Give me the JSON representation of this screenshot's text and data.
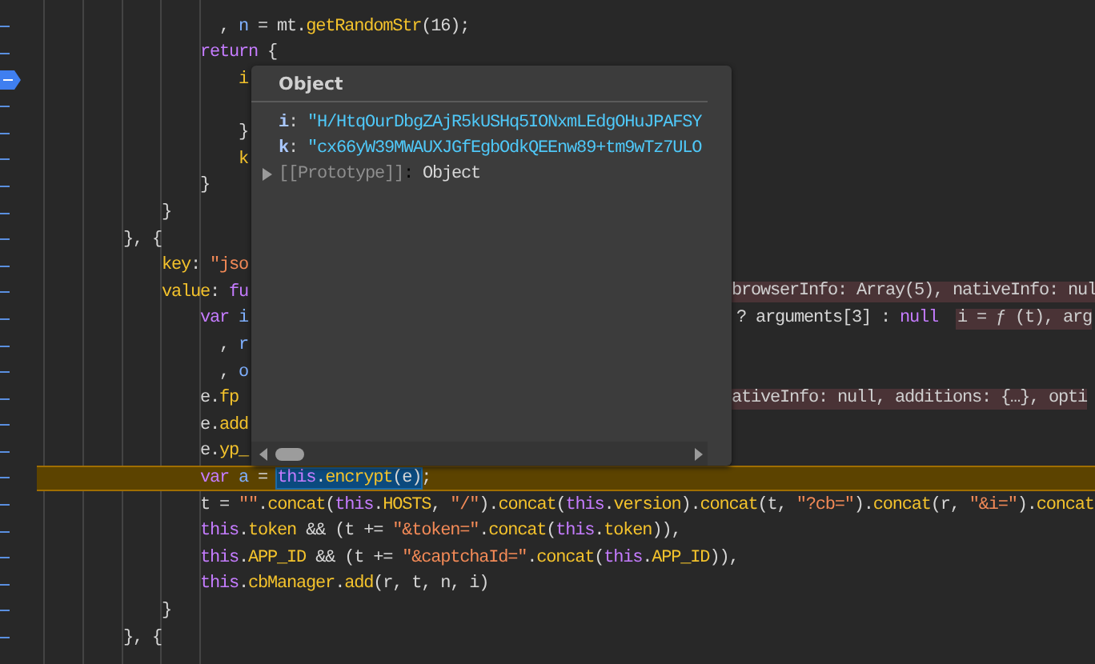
{
  "lines": [
    {
      "breakpoint": false,
      "current": false,
      "tokens": [
        {
          "kind": "pl",
          "t": "                  , "
        },
        {
          "kind": "id",
          "t": "n"
        },
        {
          "kind": "pl",
          "t": " = mt."
        },
        {
          "kind": "fn",
          "t": "getRandomStr"
        },
        {
          "kind": "pl",
          "t": "(16);"
        }
      ]
    },
    {
      "breakpoint": false,
      "current": false,
      "tokens": [
        {
          "kind": "kw",
          "t": "                return"
        },
        {
          "kind": "pl",
          "t": " {"
        }
      ]
    },
    {
      "breakpoint": true,
      "current": false,
      "tokens": [
        {
          "kind": "fn",
          "t": "                    i"
        }
      ]
    },
    {
      "breakpoint": false,
      "current": false
    },
    {
      "breakpoint": false,
      "current": false,
      "tokens": [
        {
          "kind": "pl",
          "t": "                    }"
        }
      ]
    },
    {
      "breakpoint": false,
      "current": false,
      "tokens": [
        {
          "kind": "fn",
          "t": "                    k"
        }
      ]
    },
    {
      "breakpoint": false,
      "current": false,
      "tokens": [
        {
          "kind": "pl",
          "t": "                }"
        }
      ]
    },
    {
      "breakpoint": false,
      "current": false,
      "tokens": [
        {
          "kind": "pl",
          "t": "            }"
        }
      ]
    },
    {
      "breakpoint": false,
      "current": false,
      "tokens": [
        {
          "kind": "pl",
          "t": "        }, {"
        }
      ]
    },
    {
      "breakpoint": false,
      "current": false,
      "tokens": [
        {
          "kind": "fn",
          "t": "            key"
        },
        {
          "kind": "pl",
          "t": ": "
        },
        {
          "kind": "str",
          "t": "\"jso"
        }
      ]
    },
    {
      "breakpoint": false,
      "current": false,
      "tokens": [
        {
          "kind": "fn",
          "t": "            value"
        },
        {
          "kind": "pl",
          "t": ": "
        },
        {
          "kind": "kw",
          "t": "fu"
        }
      ],
      "inline": "browserInfo: Array(5), nativeInfo: nul"
    },
    {
      "breakpoint": false,
      "current": false,
      "tokens": [
        {
          "kind": "kw",
          "t": "                var"
        },
        {
          "kind": "id",
          "t": " i"
        }
      ],
      "right": [
        {
          "kind": "pl",
          "t": "? arguments[3] : "
        },
        {
          "kind": "kw",
          "t": "null"
        }
      ],
      "inline": "i = ƒ (t), arg"
    },
    {
      "breakpoint": false,
      "current": false,
      "tokens": [
        {
          "kind": "pl",
          "t": "                  , "
        },
        {
          "kind": "id",
          "t": "r"
        }
      ]
    },
    {
      "breakpoint": false,
      "current": false,
      "tokens": [
        {
          "kind": "pl",
          "t": "                  , "
        },
        {
          "kind": "id",
          "t": "o"
        }
      ]
    },
    {
      "breakpoint": false,
      "current": false,
      "tokens": [
        {
          "kind": "pl",
          "t": "                e."
        },
        {
          "kind": "fn",
          "t": "fp"
        }
      ],
      "inline": "ativeInfo: null, additions: {…}, opti"
    },
    {
      "breakpoint": false,
      "current": false,
      "tokens": [
        {
          "kind": "pl",
          "t": "                e."
        },
        {
          "kind": "fn",
          "t": "add"
        }
      ]
    },
    {
      "breakpoint": false,
      "current": false,
      "tokens": [
        {
          "kind": "pl",
          "t": "                e."
        },
        {
          "kind": "fn",
          "t": "yp_"
        }
      ]
    },
    {
      "breakpoint": false,
      "current": true,
      "tokens": [
        {
          "kind": "kw",
          "t": "                var"
        },
        {
          "kind": "id",
          "t": " a"
        },
        {
          "kind": "pl",
          "t": " = "
        },
        {
          "kind": "selection",
          "tokens": [
            {
              "kind": "kw",
              "t": "this"
            },
            {
              "kind": "pl",
              "t": "."
            },
            {
              "kind": "fn",
              "t": "encrypt"
            },
            {
              "kind": "pl",
              "t": "(e)"
            }
          ]
        },
        {
          "kind": "pl",
          "t": ";"
        }
      ]
    },
    {
      "breakpoint": false,
      "current": false,
      "tokens": [
        {
          "kind": "pl",
          "t": "                t = "
        },
        {
          "kind": "str",
          "t": "\"\""
        },
        {
          "kind": "pl",
          "t": "."
        },
        {
          "kind": "fn",
          "t": "concat"
        },
        {
          "kind": "pl",
          "t": "("
        },
        {
          "kind": "kw",
          "t": "this"
        },
        {
          "kind": "pl",
          "t": "."
        },
        {
          "kind": "fn",
          "t": "HOSTS"
        },
        {
          "kind": "pl",
          "t": ", "
        },
        {
          "kind": "str",
          "t": "\"/\""
        },
        {
          "kind": "pl",
          "t": ")."
        },
        {
          "kind": "fn",
          "t": "concat"
        },
        {
          "kind": "pl",
          "t": "("
        },
        {
          "kind": "kw",
          "t": "this"
        },
        {
          "kind": "pl",
          "t": "."
        },
        {
          "kind": "fn",
          "t": "version"
        },
        {
          "kind": "pl",
          "t": ")."
        },
        {
          "kind": "fn",
          "t": "concat"
        },
        {
          "kind": "pl",
          "t": "(t, "
        },
        {
          "kind": "str",
          "t": "\"?cb=\""
        },
        {
          "kind": "pl",
          "t": ")."
        },
        {
          "kind": "fn",
          "t": "concat"
        },
        {
          "kind": "pl",
          "t": "(r, "
        },
        {
          "kind": "str",
          "t": "\"&i=\""
        },
        {
          "kind": "pl",
          "t": ")."
        },
        {
          "kind": "fn",
          "t": "concat"
        }
      ]
    },
    {
      "breakpoint": false,
      "current": false,
      "tokens": [
        {
          "kind": "kw",
          "t": "                this"
        },
        {
          "kind": "pl",
          "t": "."
        },
        {
          "kind": "fn",
          "t": "token"
        },
        {
          "kind": "pl",
          "t": " && (t += "
        },
        {
          "kind": "str",
          "t": "\"&token=\""
        },
        {
          "kind": "pl",
          "t": "."
        },
        {
          "kind": "fn",
          "t": "concat"
        },
        {
          "kind": "pl",
          "t": "("
        },
        {
          "kind": "kw",
          "t": "this"
        },
        {
          "kind": "pl",
          "t": "."
        },
        {
          "kind": "fn",
          "t": "token"
        },
        {
          "kind": "pl",
          "t": ")),"
        }
      ]
    },
    {
      "breakpoint": false,
      "current": false,
      "tokens": [
        {
          "kind": "kw",
          "t": "                this"
        },
        {
          "kind": "pl",
          "t": "."
        },
        {
          "kind": "fn",
          "t": "APP_ID"
        },
        {
          "kind": "pl",
          "t": " && (t += "
        },
        {
          "kind": "str",
          "t": "\"&captchaId=\""
        },
        {
          "kind": "pl",
          "t": "."
        },
        {
          "kind": "fn",
          "t": "concat"
        },
        {
          "kind": "pl",
          "t": "("
        },
        {
          "kind": "kw",
          "t": "this"
        },
        {
          "kind": "pl",
          "t": "."
        },
        {
          "kind": "fn",
          "t": "APP_ID"
        },
        {
          "kind": "pl",
          "t": ")),"
        }
      ]
    },
    {
      "breakpoint": false,
      "current": false,
      "tokens": [
        {
          "kind": "kw",
          "t": "                this"
        },
        {
          "kind": "pl",
          "t": "."
        },
        {
          "kind": "fn",
          "t": "cbManager"
        },
        {
          "kind": "pl",
          "t": "."
        },
        {
          "kind": "fn",
          "t": "add"
        },
        {
          "kind": "pl",
          "t": "(r, t, n, i)"
        }
      ]
    },
    {
      "breakpoint": false,
      "current": false,
      "tokens": [
        {
          "kind": "pl",
          "t": "            }"
        }
      ]
    },
    {
      "breakpoint": false,
      "current": false,
      "tokens": [
        {
          "kind": "pl",
          "t": "        }, {"
        }
      ]
    }
  ],
  "popup": {
    "title": "Object",
    "properties": [
      {
        "key": "i",
        "separator": ":",
        "value": "\"H/HtqOurDbgZAjR5kUSHq5IONxmLEdgOHuJPAFSY"
      },
      {
        "key": "k",
        "separator": ":",
        "value": "\"cx66yW39MWAUXJGfEgbOdkQEEnw89+tm9wTz7ULO"
      }
    ],
    "prototype": {
      "label": "[[Prototype]]",
      "separator": ":",
      "value": "Object",
      "expanded": false
    }
  }
}
